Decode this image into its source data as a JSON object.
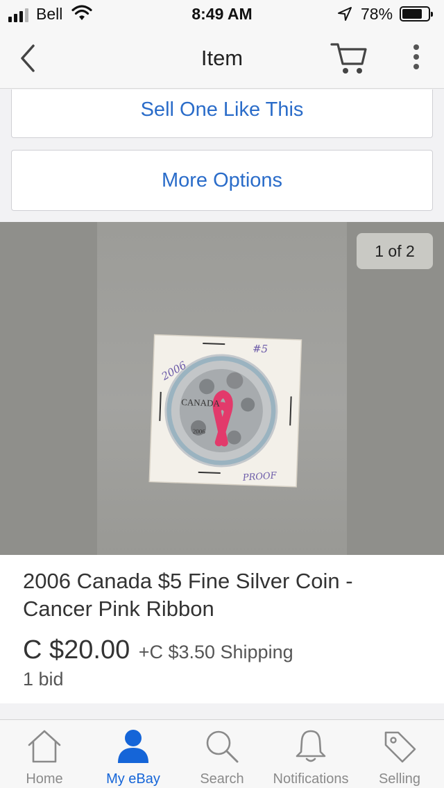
{
  "status_bar": {
    "carrier": "Bell",
    "time": "8:49 AM",
    "battery_percent": "78%",
    "battery_level": 0.78,
    "signal_icon": "cellular-signal-icon",
    "wifi_icon": "wifi-icon",
    "location_icon": "location-arrow-icon"
  },
  "nav": {
    "title": "Item",
    "back_icon": "chevron-left-icon",
    "cart_icon": "shopping-cart-icon",
    "more_icon": "more-vertical-icon"
  },
  "actions": {
    "sell_label": "Sell One Like This",
    "more_options_label": "More Options"
  },
  "gallery": {
    "counter": "1 of 2",
    "coin_marks": {
      "year_note": "2006",
      "value_note": "#5",
      "grade_note": "PROOF",
      "coin_text": "CANADA",
      "coin_year": "2006"
    }
  },
  "item": {
    "title": "2006 Canada $5 Fine Silver Coin - Cancer Pink Ribbon",
    "price": "C $20.00",
    "shipping": "+C $3.50 Shipping",
    "bids": "1 bid"
  },
  "tabs": [
    {
      "label": "Home",
      "icon": "home-icon",
      "active": false
    },
    {
      "label": "My eBay",
      "icon": "person-icon",
      "active": true
    },
    {
      "label": "Search",
      "icon": "search-icon",
      "active": false
    },
    {
      "label": "Notifications",
      "icon": "bell-icon",
      "active": false
    },
    {
      "label": "Selling",
      "icon": "tag-icon",
      "active": false
    }
  ],
  "colors": {
    "accent": "#2a6cc9",
    "active_tab": "#1565d8",
    "ribbon": "#e23a6b"
  }
}
